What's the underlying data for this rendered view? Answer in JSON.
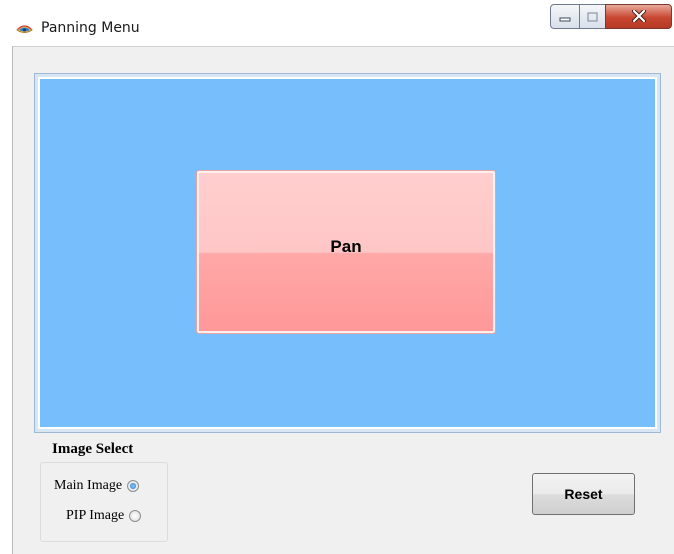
{
  "window": {
    "title": "Panning Menu",
    "icon": "eye-icon"
  },
  "controls": {
    "minimize_icon": "minimize-icon",
    "maximize_icon": "maximize-icon",
    "close_icon": "close-icon"
  },
  "pan_area": {
    "background_color": "#76bffc",
    "button_label": "Pan",
    "button_color": "#ffb3b3"
  },
  "image_select": {
    "title": "Image Select",
    "options": [
      {
        "label": "Main Image",
        "checked": true
      },
      {
        "label": "PIP Image",
        "checked": false
      }
    ]
  },
  "reset_label": "Reset"
}
